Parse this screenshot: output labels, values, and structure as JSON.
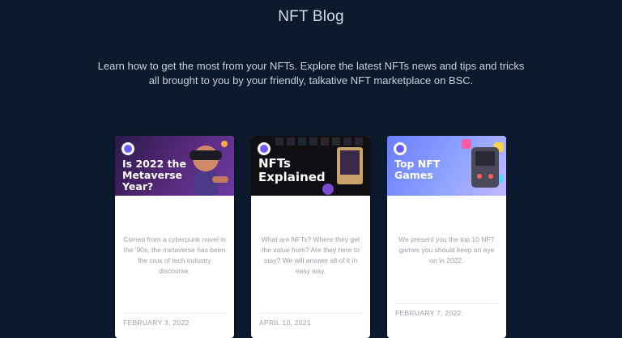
{
  "page": {
    "title": "NFT Blog",
    "intro_line1": "Learn how to get the most from your NFTs. Explore the latest NFTs news and tips and tricks",
    "intro_line2": "all brought to you by your friendly, talkative NFT marketplace on BSC."
  },
  "cards": [
    {
      "banner_line1": "Is 2022 the",
      "banner_line2": "Metaverse",
      "banner_line3": "Year?",
      "description": "Coined from a cyberpunk novel in the '90s, the metaverse has been the crux of tech industry discourse.",
      "date": "FEBRUARY 3, 2022"
    },
    {
      "banner_line1": "NFTs",
      "banner_line2": "Explained",
      "description": "What are NFTs? Where they get the value from? Are they here to stay? We will answer all of it in easy way.",
      "date": "APRIL 10, 2021"
    },
    {
      "banner_line1": "Top NFT",
      "banner_line2": "Games",
      "description": "We present you the top 10 NFT games you should keep an eye on in 2022.",
      "date": "FEBRUARY 7, 2022"
    }
  ],
  "colors": {
    "background": "#0b1a2d",
    "card": "#ffffff",
    "muted_text": "#9aa0a8",
    "brand_logo": "#6a5cff"
  },
  "icons": [
    "marketplace-logo-icon",
    "vr-avatar-illustration",
    "nft-collection-illustration",
    "game-console-illustration"
  ]
}
